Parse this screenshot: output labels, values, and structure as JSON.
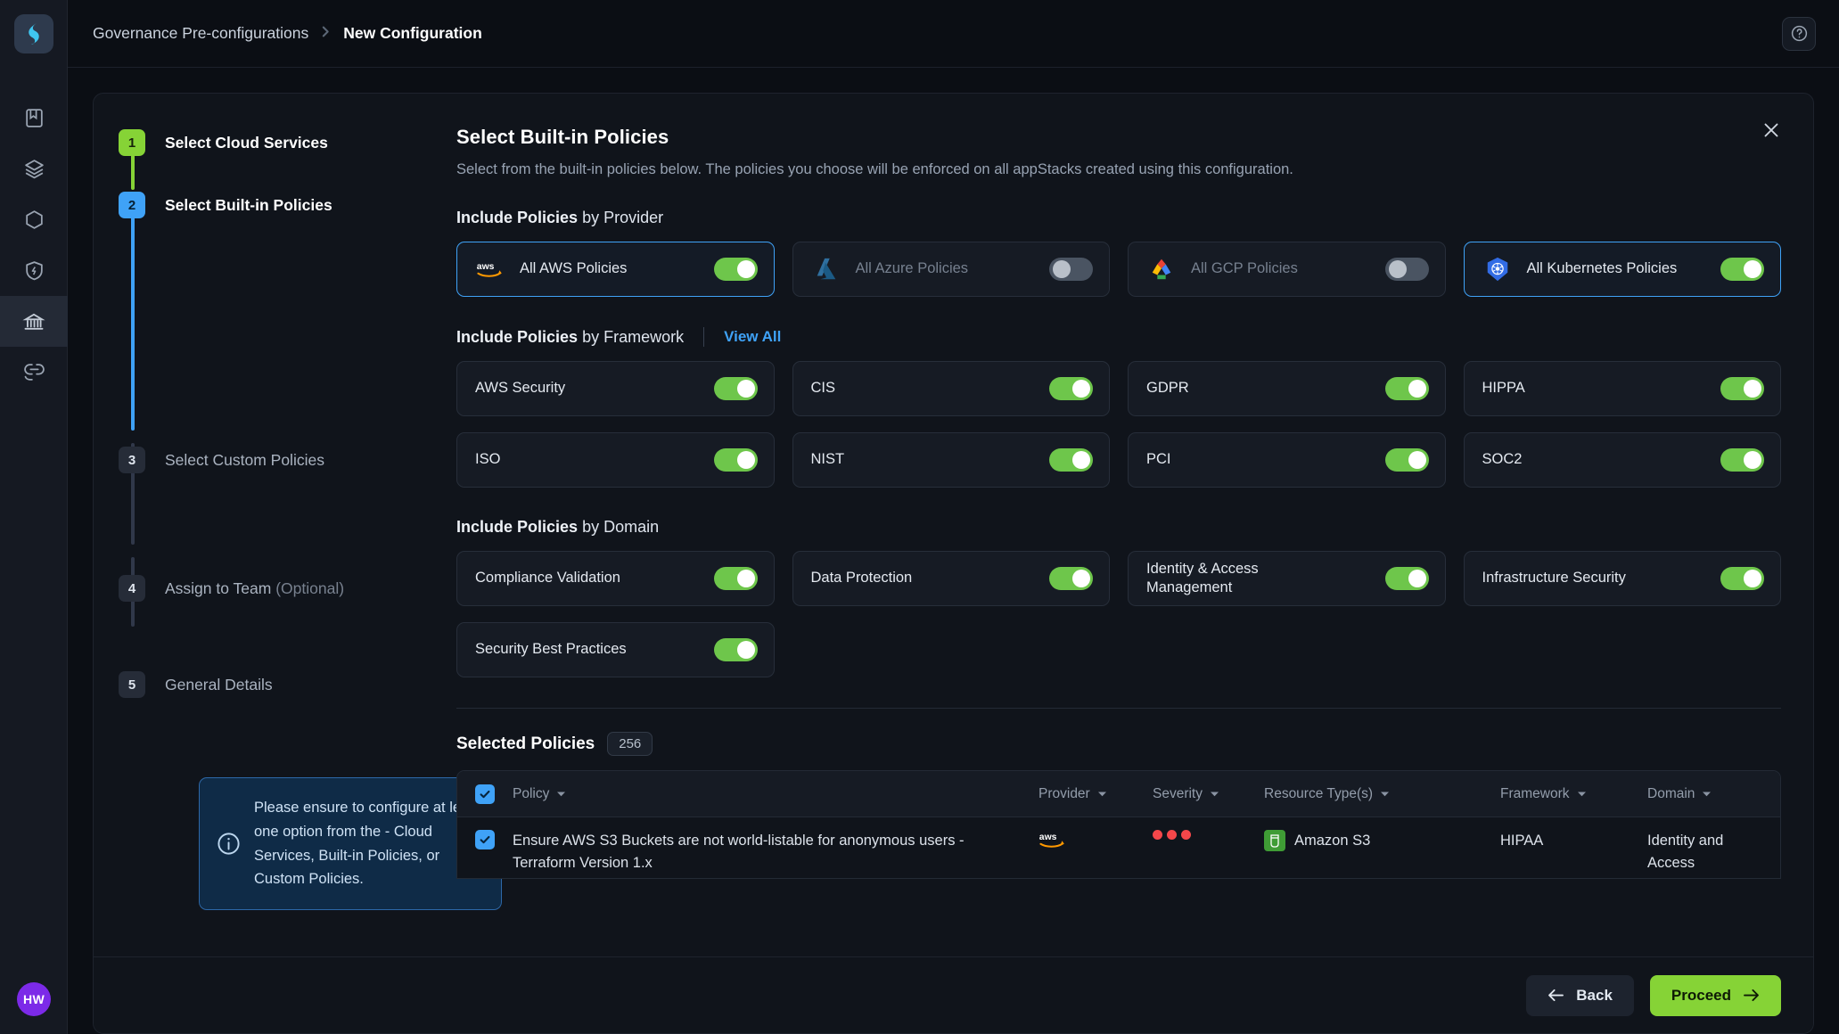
{
  "app": {
    "logo_icon": "app-logo-icon",
    "avatar_initials": "HW"
  },
  "rail": {
    "items": [
      {
        "icon": "book-icon",
        "name": "sidebar-item-library",
        "active": false
      },
      {
        "icon": "layers-icon",
        "name": "sidebar-item-stacks",
        "active": false
      },
      {
        "icon": "hexagon-icon",
        "name": "sidebar-item-resources",
        "active": false
      },
      {
        "icon": "shield-bolt-icon",
        "name": "sidebar-item-security",
        "active": false
      },
      {
        "icon": "bank-icon",
        "name": "sidebar-item-governance",
        "active": true
      },
      {
        "icon": "link-icon",
        "name": "sidebar-item-integrations",
        "active": false
      }
    ]
  },
  "breadcrumb": {
    "parent": "Governance Pre-configurations",
    "separator": "›",
    "current": "New Configuration",
    "help_icon": "help-circle-icon"
  },
  "stepper": {
    "steps": [
      {
        "num": "1",
        "label": "Select Cloud Services",
        "optional": "",
        "state": "done"
      },
      {
        "num": "2",
        "label": "Select Built-in Policies",
        "optional": "",
        "state": "active"
      },
      {
        "num": "3",
        "label": "Select Custom Policies",
        "optional": "",
        "state": "idle"
      },
      {
        "num": "4",
        "label": "Assign to Team",
        "optional": "(Optional)",
        "state": "idle"
      },
      {
        "num": "5",
        "label": "General Details",
        "optional": "",
        "state": "idle"
      }
    ],
    "info": {
      "icon": "info-circle-icon",
      "text": "Please ensure to configure at least one option from the - Cloud Services, Built-in Policies, or Custom Policies."
    }
  },
  "content": {
    "title": "Select Built-in Policies",
    "subtitle": "Select from the built-in policies below. The policies you choose will be enforced on all appStacks created using this configuration.",
    "close_icon": "close-icon",
    "provider_section": {
      "heading_strong": "Include Policies",
      "heading_thin": "by Provider",
      "cards": [
        {
          "label": "All AWS Policies",
          "logo": "aws-logo-icon",
          "on": true,
          "selected": true
        },
        {
          "label": "All Azure Policies",
          "logo": "azure-logo-icon",
          "on": false,
          "selected": false
        },
        {
          "label": "All GCP Policies",
          "logo": "gcp-logo-icon",
          "on": false,
          "selected": false
        },
        {
          "label": "All Kubernetes Policies",
          "logo": "kubernetes-logo-icon",
          "on": true,
          "selected": true
        }
      ]
    },
    "framework_section": {
      "heading_strong": "Include Policies",
      "heading_thin": "by Framework",
      "view_all": "View All",
      "cards": [
        {
          "label": "AWS Security",
          "on": true
        },
        {
          "label": "CIS",
          "on": true
        },
        {
          "label": "GDPR",
          "on": true
        },
        {
          "label": "HIPPA",
          "on": true
        },
        {
          "label": "ISO",
          "on": true
        },
        {
          "label": "NIST",
          "on": true
        },
        {
          "label": "PCI",
          "on": true
        },
        {
          "label": "SOC2",
          "on": true
        }
      ]
    },
    "domain_section": {
      "heading_strong": "Include Policies",
      "heading_thin": "by Domain",
      "cards": [
        {
          "label": "Compliance Validation",
          "on": true
        },
        {
          "label": "Data Protection",
          "on": true
        },
        {
          "label": "Identity & Access Management",
          "on": true
        },
        {
          "label": "Infrastructure Security",
          "on": true
        },
        {
          "label": "Security Best Practices",
          "on": true
        }
      ]
    },
    "selected_policies": {
      "title": "Selected Policies",
      "count": "256",
      "columns": [
        {
          "label": "Policy",
          "sortable": true
        },
        {
          "label": "Provider",
          "sortable": true
        },
        {
          "label": "Severity",
          "sortable": true
        },
        {
          "label": "Resource Type(s)",
          "sortable": true
        },
        {
          "label": "Framework",
          "sortable": true
        },
        {
          "label": "Domain",
          "sortable": true
        }
      ],
      "header_checked": true,
      "rows": [
        {
          "checked": true,
          "policy": "Ensure AWS S3 Buckets are not world-listable for anonymous users - Terraform Version 1.x",
          "provider": "aws-logo-icon",
          "severity_dots": 3,
          "severity_color": "#f4474a",
          "resource_icon": "s3-bucket-icon",
          "resource": "Amazon S3",
          "framework": "HIPAA",
          "domain": "Identity and Access Management"
        }
      ]
    }
  },
  "footer": {
    "back_label": "Back",
    "back_icon": "arrow-left-icon",
    "proceed_label": "Proceed",
    "proceed_icon": "arrow-right-icon"
  },
  "colors": {
    "accent_blue": "#3fa2f7",
    "accent_green": "#86d336",
    "toggle_on": "#6ec64b",
    "toggle_off": "#4a5462",
    "severity_red": "#f4474a",
    "avatar_purple": "#7c2ae8"
  }
}
